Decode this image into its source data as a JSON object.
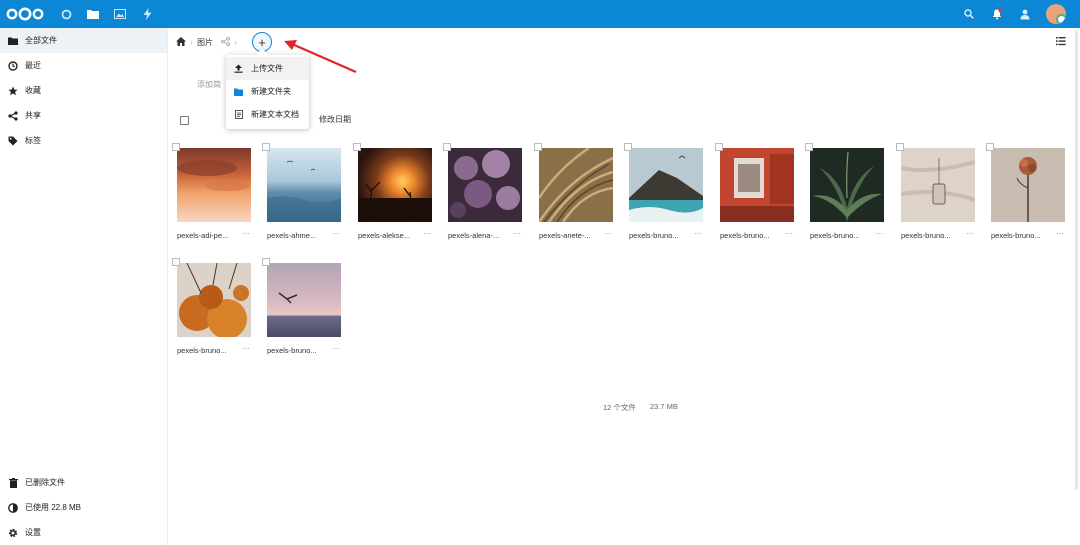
{
  "header": {
    "apps": [
      "dashboard-icon",
      "files-icon",
      "photos-icon",
      "activity-icon"
    ],
    "right_icons": [
      "search-icon",
      "notifications-icon",
      "contacts-icon",
      "avatar"
    ],
    "accent": "#0b87d6"
  },
  "sidebar": {
    "items": [
      {
        "label": "全部文件",
        "icon": "folder-icon"
      },
      {
        "label": "最近",
        "icon": "clock-icon"
      },
      {
        "label": "收藏",
        "icon": "star-icon"
      },
      {
        "label": "共享",
        "icon": "share-icon"
      },
      {
        "label": "标签",
        "icon": "tag-icon"
      }
    ],
    "bottom": [
      {
        "label": "已删除文件",
        "icon": "trash-icon"
      },
      {
        "label": "已使用 22.8 MB",
        "icon": "quota-icon"
      },
      {
        "label": "设置",
        "icon": "gear-icon"
      }
    ]
  },
  "breadcrumb": {
    "folder": "图片"
  },
  "add_menu": {
    "items": [
      {
        "label": "上传文件",
        "icon": "upload-icon"
      },
      {
        "label": "新建文件夹",
        "icon": "folder-icon"
      },
      {
        "label": "新建文本文档",
        "icon": "text-document-icon"
      }
    ]
  },
  "description_placeholder": "添加简",
  "list_header": {
    "modified_label": "修改日期"
  },
  "files": [
    {
      "name": "pexels-adi-pe...",
      "more": "···"
    },
    {
      "name": "pexels-ahme...",
      "more": "···"
    },
    {
      "name": "pexels-alekse...",
      "more": "···"
    },
    {
      "name": "pexels-alena-...",
      "more": "···"
    },
    {
      "name": "pexels-anete-...",
      "more": "···"
    },
    {
      "name": "pexels-bruno...",
      "more": "···"
    },
    {
      "name": "pexels-bruno...",
      "more": "···"
    },
    {
      "name": "pexels-bruno...",
      "more": "···"
    },
    {
      "name": "pexels-bruno...",
      "more": "···"
    },
    {
      "name": "pexels-bruno...",
      "more": "···"
    },
    {
      "name": "pexels-bruno...",
      "more": "···"
    },
    {
      "name": "pexels-bruno...",
      "more": "···"
    }
  ],
  "summary": {
    "files": "12 个文件",
    "size": "23.7 MB"
  }
}
